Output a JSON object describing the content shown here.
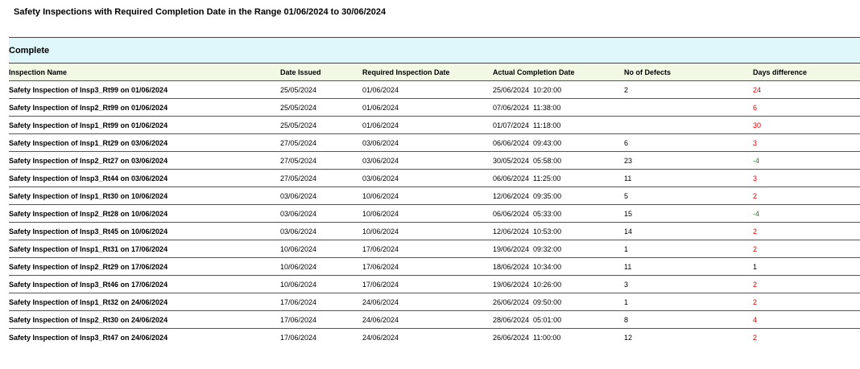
{
  "title": "Safety Inspections with Required Completion Date in the Range 01/06/2024 to 30/06/2024",
  "section": "Complete",
  "columns": [
    "Inspection Name",
    "Date Issued",
    "Required Inspection Date",
    "Actual Completion Date",
    "No of Defects",
    "Days difference"
  ],
  "rows": [
    {
      "name": "Safety Inspection of Insp3_Rt99 on 01/06/2024",
      "issued": "25/05/2024",
      "required": "01/06/2024",
      "actual": "25/06/2024  10:20:00",
      "defects": "2",
      "diff": "24",
      "diff_color": "#e00000"
    },
    {
      "name": "Safety Inspection of Insp2_Rt99 on 01/06/2024",
      "issued": "25/05/2024",
      "required": "01/06/2024",
      "actual": "07/06/2024  11:38:00",
      "defects": "",
      "diff": "6",
      "diff_color": "#e00000"
    },
    {
      "name": "Safety Inspection of Insp1_Rt99 on 01/06/2024",
      "issued": "25/05/2024",
      "required": "01/06/2024",
      "actual": "01/07/2024  11:18:00",
      "defects": "",
      "diff": "30",
      "diff_color": "#e00000"
    },
    {
      "name": "Safety Inspection of Insp1_Rt29 on 03/06/2024",
      "issued": "27/05/2024",
      "required": "03/06/2024",
      "actual": "06/06/2024  09:43:00",
      "defects": "6",
      "diff": "3",
      "diff_color": "#e00000"
    },
    {
      "name": "Safety Inspection of Insp2_Rt27 on 03/06/2024",
      "issued": "27/05/2024",
      "required": "03/06/2024",
      "actual": "30/05/2024  05:58:00",
      "defects": "23",
      "diff": "-4",
      "diff_color": "#1a8a1a"
    },
    {
      "name": "Safety Inspection of Insp3_Rt44 on 03/06/2024",
      "issued": "27/05/2024",
      "required": "03/06/2024",
      "actual": "06/06/2024  11:25:00",
      "defects": "11",
      "diff": "3",
      "diff_color": "#e00000"
    },
    {
      "name": "Safety Inspection of Insp1_Rt30 on 10/06/2024",
      "issued": "03/06/2024",
      "required": "10/06/2024",
      "actual": "12/06/2024  09:35:00",
      "defects": "5",
      "diff": "2",
      "diff_color": "#e00000"
    },
    {
      "name": "Safety Inspection of Insp2_Rt28 on 10/06/2024",
      "issued": "03/06/2024",
      "required": "10/06/2024",
      "actual": "06/06/2024  05:33:00",
      "defects": "15",
      "diff": "-4",
      "diff_color": "#1a8a1a"
    },
    {
      "name": "Safety Inspection of Insp3_Rt45 on 10/06/2024",
      "issued": "03/06/2024",
      "required": "10/06/2024",
      "actual": "12/06/2024  10:53:00",
      "defects": "14",
      "diff": "2",
      "diff_color": "#e00000"
    },
    {
      "name": "Safety Inspection of Insp1_Rt31 on 17/06/2024",
      "issued": "10/06/2024",
      "required": "17/06/2024",
      "actual": "19/06/2024  09:32:00",
      "defects": "1",
      "diff": "2",
      "diff_color": "#e00000"
    },
    {
      "name": "Safety Inspection of Insp2_Rt29 on 17/06/2024",
      "issued": "10/06/2024",
      "required": "17/06/2024",
      "actual": "18/06/2024  10:34:00",
      "defects": "11",
      "diff": "1",
      "diff_color": "#000000"
    },
    {
      "name": "Safety Inspection of Insp3_Rt46 on 17/06/2024",
      "issued": "10/06/2024",
      "required": "17/06/2024",
      "actual": "19/06/2024  10:26:00",
      "defects": "3",
      "diff": "2",
      "diff_color": "#e00000"
    },
    {
      "name": "Safety Inspection of Insp1_Rt32 on 24/06/2024",
      "issued": "17/06/2024",
      "required": "24/06/2024",
      "actual": "26/06/2024  09:50:00",
      "defects": "1",
      "diff": "2",
      "diff_color": "#e00000"
    },
    {
      "name": "Safety Inspection of Insp2_Rt30 on 24/06/2024",
      "issued": "17/06/2024",
      "required": "24/06/2024",
      "actual": "28/06/2024  05:01:00",
      "defects": "8",
      "diff": "4",
      "diff_color": "#e00000"
    },
    {
      "name": "Safety Inspection of Insp3_Rt47 on 24/06/2024",
      "issued": "17/06/2024",
      "required": "24/06/2024",
      "actual": "26/06/2024  11:00:00",
      "defects": "12",
      "diff": "2",
      "diff_color": "#e00000"
    }
  ]
}
